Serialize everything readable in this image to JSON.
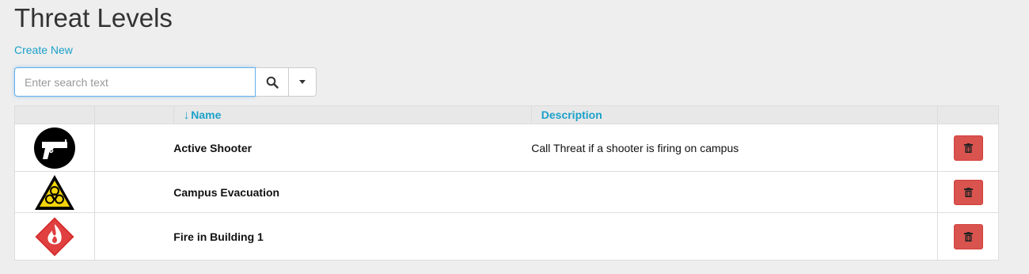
{
  "page": {
    "title": "Threat Levels",
    "create_link": "Create New"
  },
  "search": {
    "placeholder": "Enter search text",
    "value": ""
  },
  "table": {
    "columns": [
      {
        "key": "icon",
        "label": ""
      },
      {
        "key": "spacer",
        "label": ""
      },
      {
        "key": "name",
        "label": "Name",
        "sort": "ascending"
      },
      {
        "key": "description",
        "label": "Description"
      },
      {
        "key": "actions",
        "label": ""
      }
    ],
    "rows": [
      {
        "icon": "pistol-icon",
        "name": "Active Shooter",
        "description": "Call Threat if a shooter is firing on campus"
      },
      {
        "icon": "biohazard-warning-icon",
        "name": "Campus Evacuation",
        "description": ""
      },
      {
        "icon": "fire-diamond-icon",
        "name": "Fire in Building 1",
        "description": ""
      }
    ]
  },
  "colors": {
    "accent": "#1ba1c9",
    "danger": "#d9534f",
    "focus": "#66afe9"
  },
  "icons": {
    "search": "search-icon",
    "dropdown": "caret-down-icon",
    "delete": "trash-icon",
    "sort": "sort-down-arrow-icon"
  }
}
